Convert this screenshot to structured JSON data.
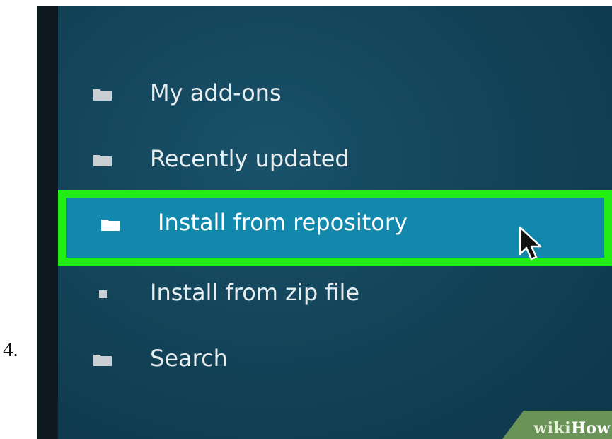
{
  "step": {
    "number": "4."
  },
  "menu": {
    "items": [
      {
        "label": "My add-ons",
        "icon": "folder-icon",
        "selected": false
      },
      {
        "label": "Recently updated",
        "icon": "folder-icon",
        "selected": false
      },
      {
        "label": "Install from repository",
        "icon": "folder-icon",
        "selected": true
      },
      {
        "label": "Install from zip file",
        "icon": "square-icon",
        "selected": false
      },
      {
        "label": "Search",
        "icon": "folder-icon",
        "selected": false
      }
    ]
  },
  "watermark": {
    "wiki": "wiki",
    "how": "How"
  },
  "colors": {
    "background": "#134459",
    "selected_background": "#1388ad",
    "highlight_border": "#22ee15",
    "text": "#e8edf0"
  }
}
